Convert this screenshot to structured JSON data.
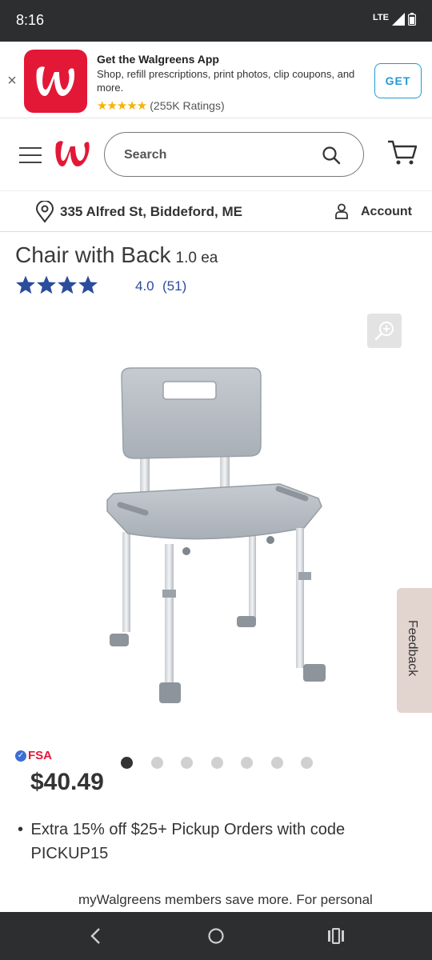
{
  "status_bar": {
    "time": "8:16",
    "network": "LTE"
  },
  "app_banner": {
    "title": "Get the Walgreens App",
    "description": "Shop, refill prescriptions, print photos, clip coupons, and more.",
    "stars": "★★★★★",
    "ratings": "(255K Ratings)",
    "get_label": "GET",
    "brand_color": "#e31837"
  },
  "header": {
    "search_placeholder": "Search"
  },
  "location_bar": {
    "address": "335 Alfred St, Biddeford, ME",
    "account_label": "Account"
  },
  "product": {
    "title": "Chair with Back",
    "size": "1.0 ea",
    "rating": "4.0",
    "reviews": "(51)",
    "stars_filled": 4,
    "fsa_label": "FSA",
    "price": "$40.49",
    "carousel_count": 7,
    "carousel_active": 1
  },
  "promo": {
    "text": "Extra 15% off $25+ Pickup Orders with code PICKUP15"
  },
  "members_text": "myWalgreens members save more. For personal",
  "feedback_label": "Feedback"
}
